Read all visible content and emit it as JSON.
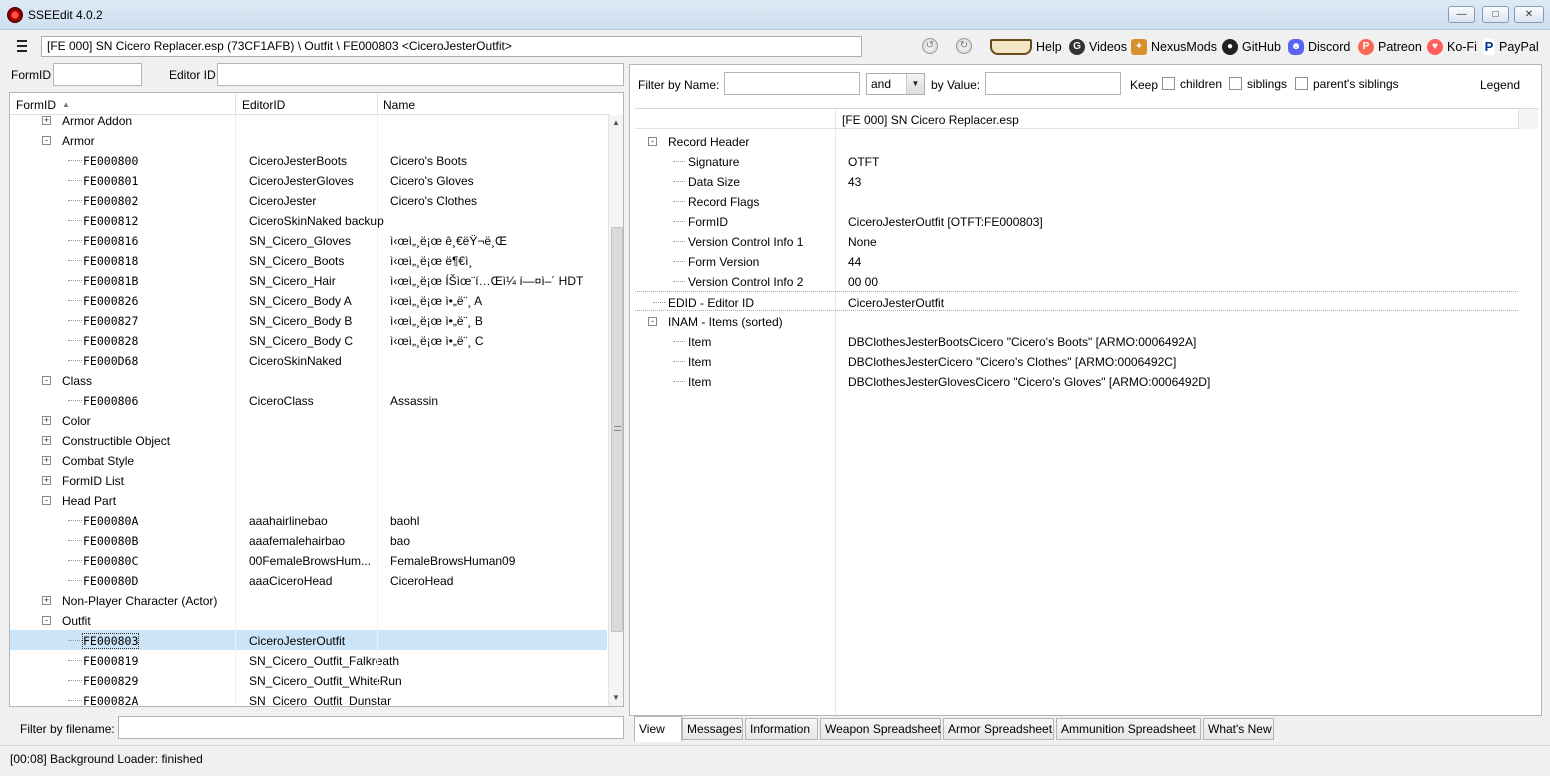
{
  "window": {
    "title": "SSEEdit 4.0.2"
  },
  "toolbar": {
    "path": "[FE 000] SN Cicero Replacer.esp (73CF1AFB) \\ Outfit \\ FE000803 <CiceroJesterOutfit>",
    "links": [
      "Help",
      "Videos",
      "NexusMods",
      "GitHub",
      "Discord",
      "Patreon",
      "Ko-Fi",
      "PayPal"
    ]
  },
  "left": {
    "formid_label": "FormID",
    "editorid_label": "Editor ID",
    "columns": [
      "FormID",
      "EditorID",
      "Name"
    ],
    "filter_filename_label": "Filter by filename:"
  },
  "tree_rows": [
    {
      "kind": "group",
      "label": "Armor Addon",
      "exp": "+"
    },
    {
      "kind": "group",
      "label": "Armor",
      "exp": "-"
    },
    {
      "kind": "rec",
      "fid": "FE000800",
      "eid": "CiceroJesterBoots",
      "name": "Cicero's Boots"
    },
    {
      "kind": "rec",
      "fid": "FE000801",
      "eid": "CiceroJesterGloves",
      "name": "Cicero's Gloves"
    },
    {
      "kind": "rec",
      "fid": "FE000802",
      "eid": "CiceroJester",
      "name": "Cicero's Clothes"
    },
    {
      "kind": "rec",
      "fid": "FE000812",
      "eid": "CiceroSkinNaked backup",
      "name": ""
    },
    {
      "kind": "rec",
      "fid": "FE000816",
      "eid": "SN_Cicero_Gloves",
      "name": "ì‹œì„¸ë¡œ ê¸€ëŸ¬ë¸Œ"
    },
    {
      "kind": "rec",
      "fid": "FE000818",
      "eid": "SN_Cicero_Boots",
      "name": "ì‹œì„¸ë¡œ ë¶€ì¸ "
    },
    {
      "kind": "rec",
      "fid": "FE00081B",
      "eid": "SN_Cicero_Hair",
      "name": "ì‹œì„¸ë¡œ ÍŠìœ¨í…Œì¼ í—¤ì–´ HDT"
    },
    {
      "kind": "rec",
      "fid": "FE000826",
      "eid": "SN_Cicero_Body A",
      "name": "ì‹œì„¸ë¡œ ì•„ë¨¸ A"
    },
    {
      "kind": "rec",
      "fid": "FE000827",
      "eid": "SN_Cicero_Body B",
      "name": "ì‹œì„¸ë¡œ ì•„ë¨¸ B"
    },
    {
      "kind": "rec",
      "fid": "FE000828",
      "eid": "SN_Cicero_Body C",
      "name": "ì‹œì„¸ë¡œ ì•„ë¨¸ C"
    },
    {
      "kind": "rec",
      "fid": "FE000D68",
      "eid": "CiceroSkinNaked",
      "name": ""
    },
    {
      "kind": "group",
      "label": "Class",
      "exp": "-"
    },
    {
      "kind": "rec",
      "fid": "FE000806",
      "eid": "CiceroClass",
      "name": "Assassin"
    },
    {
      "kind": "group",
      "label": "Color",
      "exp": "+"
    },
    {
      "kind": "group",
      "label": "Constructible Object",
      "exp": "+"
    },
    {
      "kind": "group",
      "label": "Combat Style",
      "exp": "+"
    },
    {
      "kind": "group",
      "label": "FormID List",
      "exp": "+"
    },
    {
      "kind": "group",
      "label": "Head Part",
      "exp": "-"
    },
    {
      "kind": "rec",
      "fid": "FE00080A",
      "eid": "aaahairlinebao",
      "name": "baohl"
    },
    {
      "kind": "rec",
      "fid": "FE00080B",
      "eid": "aaafemalehairbao",
      "name": "bao"
    },
    {
      "kind": "rec",
      "fid": "FE00080C",
      "eid": "00FemaleBrowsHum...",
      "name": "FemaleBrowsHuman09"
    },
    {
      "kind": "rec",
      "fid": "FE00080D",
      "eid": "aaaCiceroHead",
      "name": "CiceroHead"
    },
    {
      "kind": "group",
      "label": "Non-Player Character (Actor)",
      "exp": "+"
    },
    {
      "kind": "group",
      "label": "Outfit",
      "exp": "-"
    },
    {
      "kind": "rec",
      "fid": "FE000803",
      "eid": "CiceroJesterOutfit",
      "name": "",
      "selected": true
    },
    {
      "kind": "rec",
      "fid": "FE000819",
      "eid": "SN_Cicero_Outfit_Falkreath",
      "name": ""
    },
    {
      "kind": "rec",
      "fid": "FE000829",
      "eid": "SN_Cicero_Outfit_WhiteRun",
      "name": ""
    },
    {
      "kind": "rec",
      "fid": "FE00082A",
      "eid": "SN_Cicero_Outfit_Dunstar",
      "name": ""
    }
  ],
  "right": {
    "filter_name_label": "Filter by Name:",
    "and_value": "and",
    "by_value_label": "by Value:",
    "keep_label": "Keep",
    "children_label": "children",
    "siblings_label": "siblings",
    "parents_siblings_label": "parent's siblings",
    "legend_label": "Legend",
    "file_header": "[FE 000] SN Cicero Replacer.esp"
  },
  "record_rows": [
    {
      "level": 0,
      "exp": "-",
      "label": "Record Header",
      "value": ""
    },
    {
      "level": 1,
      "label": "Signature",
      "value": "OTFT"
    },
    {
      "level": 1,
      "label": "Data Size",
      "value": "43"
    },
    {
      "level": 1,
      "label": "Record Flags",
      "value": ""
    },
    {
      "level": 1,
      "label": "FormID",
      "value": "CiceroJesterOutfit [OTFT:FE000803]"
    },
    {
      "level": 1,
      "label": "Version Control Info 1",
      "value": "None"
    },
    {
      "level": 1,
      "label": "Form Version",
      "value": "44"
    },
    {
      "level": 1,
      "label": "Version Control Info 2",
      "value": "00 00"
    },
    {
      "level": 0,
      "label": "EDID - Editor ID",
      "value": "CiceroJesterOutfit"
    },
    {
      "level": 0,
      "exp": "-",
      "label": "INAM - Items (sorted)",
      "value": ""
    },
    {
      "level": 1,
      "label": "Item",
      "value": "DBClothesJesterBootsCicero \"Cicero's Boots\" [ARMO:0006492A]"
    },
    {
      "level": 1,
      "label": "Item",
      "value": "DBClothesJesterCicero \"Cicero's Clothes\" [ARMO:0006492C]"
    },
    {
      "level": 1,
      "label": "Item",
      "value": "DBClothesJesterGlovesCicero \"Cicero's Gloves\" [ARMO:0006492D]"
    }
  ],
  "tabs": [
    "View",
    "Messages",
    "Information",
    "Weapon Spreadsheet",
    "Armor Spreadsheet",
    "Ammunition Spreadsheet",
    "What's New"
  ],
  "status": "[00:08] Background Loader: finished"
}
